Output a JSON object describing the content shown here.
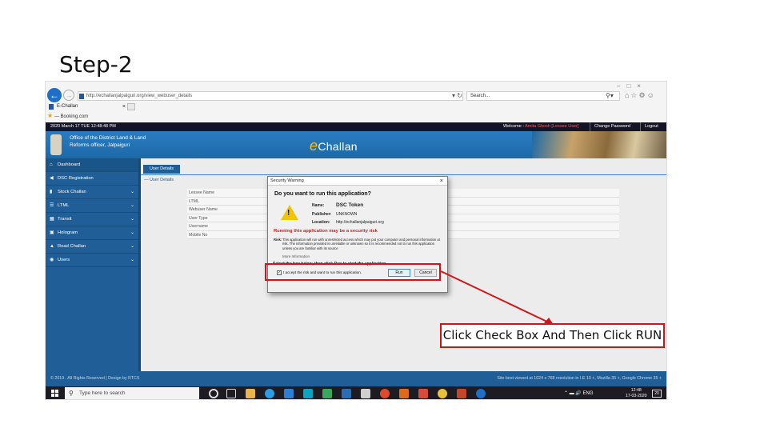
{
  "slide": {
    "title": "Step-2",
    "callout": "Click Check Box And Then Click RUN"
  },
  "browser": {
    "url": "http://echallanjalpaiguri.org/view_webuser_details",
    "search_placeholder": "Search...",
    "tab_title": "E-Challan",
    "favorite": "Booking.com",
    "icons": [
      "back-icon",
      "forward-icon",
      "refresh-icon",
      "search-icon",
      "home-icon",
      "star-icon",
      "gear-icon",
      "smiley-icon"
    ]
  },
  "app": {
    "datetime": "2020 March 17 TUE  12:48:48 PM",
    "welcome_prefix": "Welcome : ",
    "user_name": "Amita Ghosh [Lessee User]",
    "change_password": "Change Password",
    "logout": "Logout",
    "office_line1": "Office of the District Land & Land",
    "office_line2": "Reforms officer, Jalpaiguri",
    "brand_e": "e",
    "brand_rest": "Challan",
    "accent": "#1f5e96"
  },
  "sidebar": {
    "items": [
      {
        "label": "Dashboard",
        "icon": "home-icon"
      },
      {
        "label": "DSC Registration",
        "icon": "key-icon"
      },
      {
        "label": "Stock Challan",
        "icon": "book-icon"
      },
      {
        "label": "LTML",
        "icon": "list-icon"
      },
      {
        "label": "Transit",
        "icon": "truck-icon"
      },
      {
        "label": "Hologram",
        "icon": "image-icon"
      },
      {
        "label": "Road Challan",
        "icon": "car-icon"
      },
      {
        "label": "Users",
        "icon": "user-icon"
      }
    ]
  },
  "main": {
    "user_details_button": "User Details",
    "user_details_link": "User Details",
    "fields": [
      "Lessee Name",
      "LTML",
      "Webuser Name",
      "User Type",
      "Username",
      "Mobile No"
    ]
  },
  "dialog": {
    "title": "Security Warning",
    "question": "Do you want to run this application?",
    "name_label": "Name:",
    "name_value": "DSC Token",
    "publisher_label": "Publisher:",
    "publisher_value": "UNKNOWN",
    "location_label": "Location:",
    "location_value": "http://echallanjalpaiguri.org",
    "risk_heading": "Running this application may be a security risk",
    "risk_label": "Risk:",
    "risk_text": "This application will run with unrestricted access which may put your computer and personal information at risk. The information provided is unreliable or unknown so it is recommended not to run this application unless you are familiar with its source",
    "more_info": "More Information",
    "select_text": "Select the box below, then click Run to start the application",
    "accept_label": "I accept the risk and want to run this application.",
    "run_label": "Run",
    "cancel_label": "Cancel"
  },
  "footer": {
    "left": "© 2019 . All Rights Reserved | Design by RTCS",
    "right": "Site best viewed at 1024 x 768 resolution in I.E 10 +, Mozilla 35 +, Google Chrome 35 +"
  },
  "taskbar": {
    "search_placeholder": "Type here to search",
    "lang": "ENG",
    "time": "12:48",
    "date": "17-03-2020",
    "notifications": "20"
  }
}
